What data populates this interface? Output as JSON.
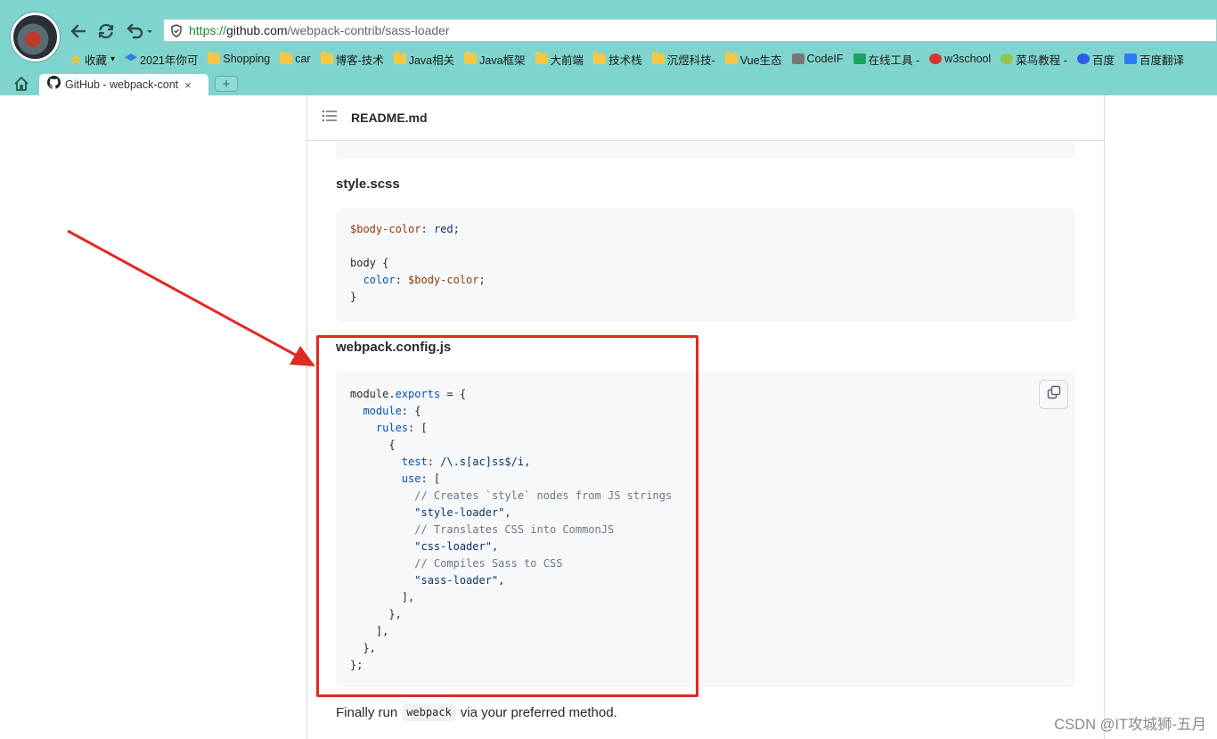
{
  "browser": {
    "url_protocol": "https://",
    "url_host": "github.com",
    "url_path": "/webpack-contrib/sass-loader",
    "bookmarks": [
      {
        "label": "收藏",
        "icon": "star-icon"
      },
      {
        "label": "2021年你可",
        "icon": "layers-icon"
      },
      {
        "label": "Shopping",
        "icon": "folder-icon"
      },
      {
        "label": "car",
        "icon": "folder-icon"
      },
      {
        "label": "博客-技术",
        "icon": "folder-icon"
      },
      {
        "label": "Java相关",
        "icon": "folder-icon"
      },
      {
        "label": "Java框架",
        "icon": "folder-icon"
      },
      {
        "label": "大前端",
        "icon": "folder-icon"
      },
      {
        "label": "技术栈",
        "icon": "folder-icon"
      },
      {
        "label": "沉煜科技-",
        "icon": "folder-icon"
      },
      {
        "label": "Vue生态",
        "icon": "folder-icon"
      },
      {
        "label": "CodeIF",
        "icon": "page-icon"
      },
      {
        "label": "在线工具 -",
        "icon": "tools-icon"
      },
      {
        "label": "w3school",
        "icon": "w3-icon"
      },
      {
        "label": "菜鸟教程 -",
        "icon": "runoob-icon"
      },
      {
        "label": "百度",
        "icon": "baidu-icon"
      },
      {
        "label": "百度翻译",
        "icon": "translate-icon"
      }
    ],
    "tab_title": "GitHub - webpack-contrib",
    "tab_close": "×",
    "new_tab": "+"
  },
  "readme": {
    "filename": "README.md",
    "style_heading": "style.scss",
    "style_code": {
      "line1_var": "$body-color",
      "line1_colon": ": ",
      "line1_val": "red",
      "line1_end": ";",
      "line3": "body {",
      "line4_key": "  color",
      "line4_colon": ": ",
      "line4_val": "$body-color",
      "line4_end": ";",
      "line5": "}"
    },
    "webpack_heading": "webpack.config.js",
    "webpack_code": [
      {
        "parts": [
          {
            "t": "module.",
            "c": "pun"
          },
          {
            "t": "exports",
            "c": "key"
          },
          {
            "t": " = {",
            "c": "pun"
          }
        ]
      },
      {
        "parts": [
          {
            "t": "  module",
            "c": "key"
          },
          {
            "t": ": {",
            "c": "pun"
          }
        ]
      },
      {
        "parts": [
          {
            "t": "    rules",
            "c": "key"
          },
          {
            "t": ": [",
            "c": "pun"
          }
        ]
      },
      {
        "parts": [
          {
            "t": "      {",
            "c": "pun"
          }
        ]
      },
      {
        "parts": [
          {
            "t": "        test",
            "c": "key"
          },
          {
            "t": ": ",
            "c": "pun"
          },
          {
            "t": "/\\.s[ac]ss$/i",
            "c": "str"
          },
          {
            "t": ",",
            "c": "pun"
          }
        ]
      },
      {
        "parts": [
          {
            "t": "        use",
            "c": "key"
          },
          {
            "t": ": [",
            "c": "pun"
          }
        ]
      },
      {
        "parts": [
          {
            "t": "          // Creates `style` nodes from JS strings",
            "c": "com"
          }
        ]
      },
      {
        "parts": [
          {
            "t": "          \"style-loader\"",
            "c": "str"
          },
          {
            "t": ",",
            "c": "pun"
          }
        ]
      },
      {
        "parts": [
          {
            "t": "          // Translates CSS into CommonJS",
            "c": "com"
          }
        ]
      },
      {
        "parts": [
          {
            "t": "          \"css-loader\"",
            "c": "str"
          },
          {
            "t": ",",
            "c": "pun"
          }
        ]
      },
      {
        "parts": [
          {
            "t": "          // Compiles Sass to CSS",
            "c": "com"
          }
        ]
      },
      {
        "parts": [
          {
            "t": "          \"sass-loader\"",
            "c": "str"
          },
          {
            "t": ",",
            "c": "pun"
          }
        ]
      },
      {
        "parts": [
          {
            "t": "        ],",
            "c": "pun"
          }
        ]
      },
      {
        "parts": [
          {
            "t": "      },",
            "c": "pun"
          }
        ]
      },
      {
        "parts": [
          {
            "t": "    ],",
            "c": "pun"
          }
        ]
      },
      {
        "parts": [
          {
            "t": "  },",
            "c": "pun"
          }
        ]
      },
      {
        "parts": [
          {
            "t": "};",
            "c": "pun"
          }
        ]
      }
    ],
    "final_before": "Finally run",
    "final_code": "webpack",
    "final_after": "via your preferred method."
  },
  "annotation": {
    "box_color": "#e02a22",
    "arrow_color": "#e02a22"
  },
  "watermark": "CSDN @IT攻城狮-五月"
}
